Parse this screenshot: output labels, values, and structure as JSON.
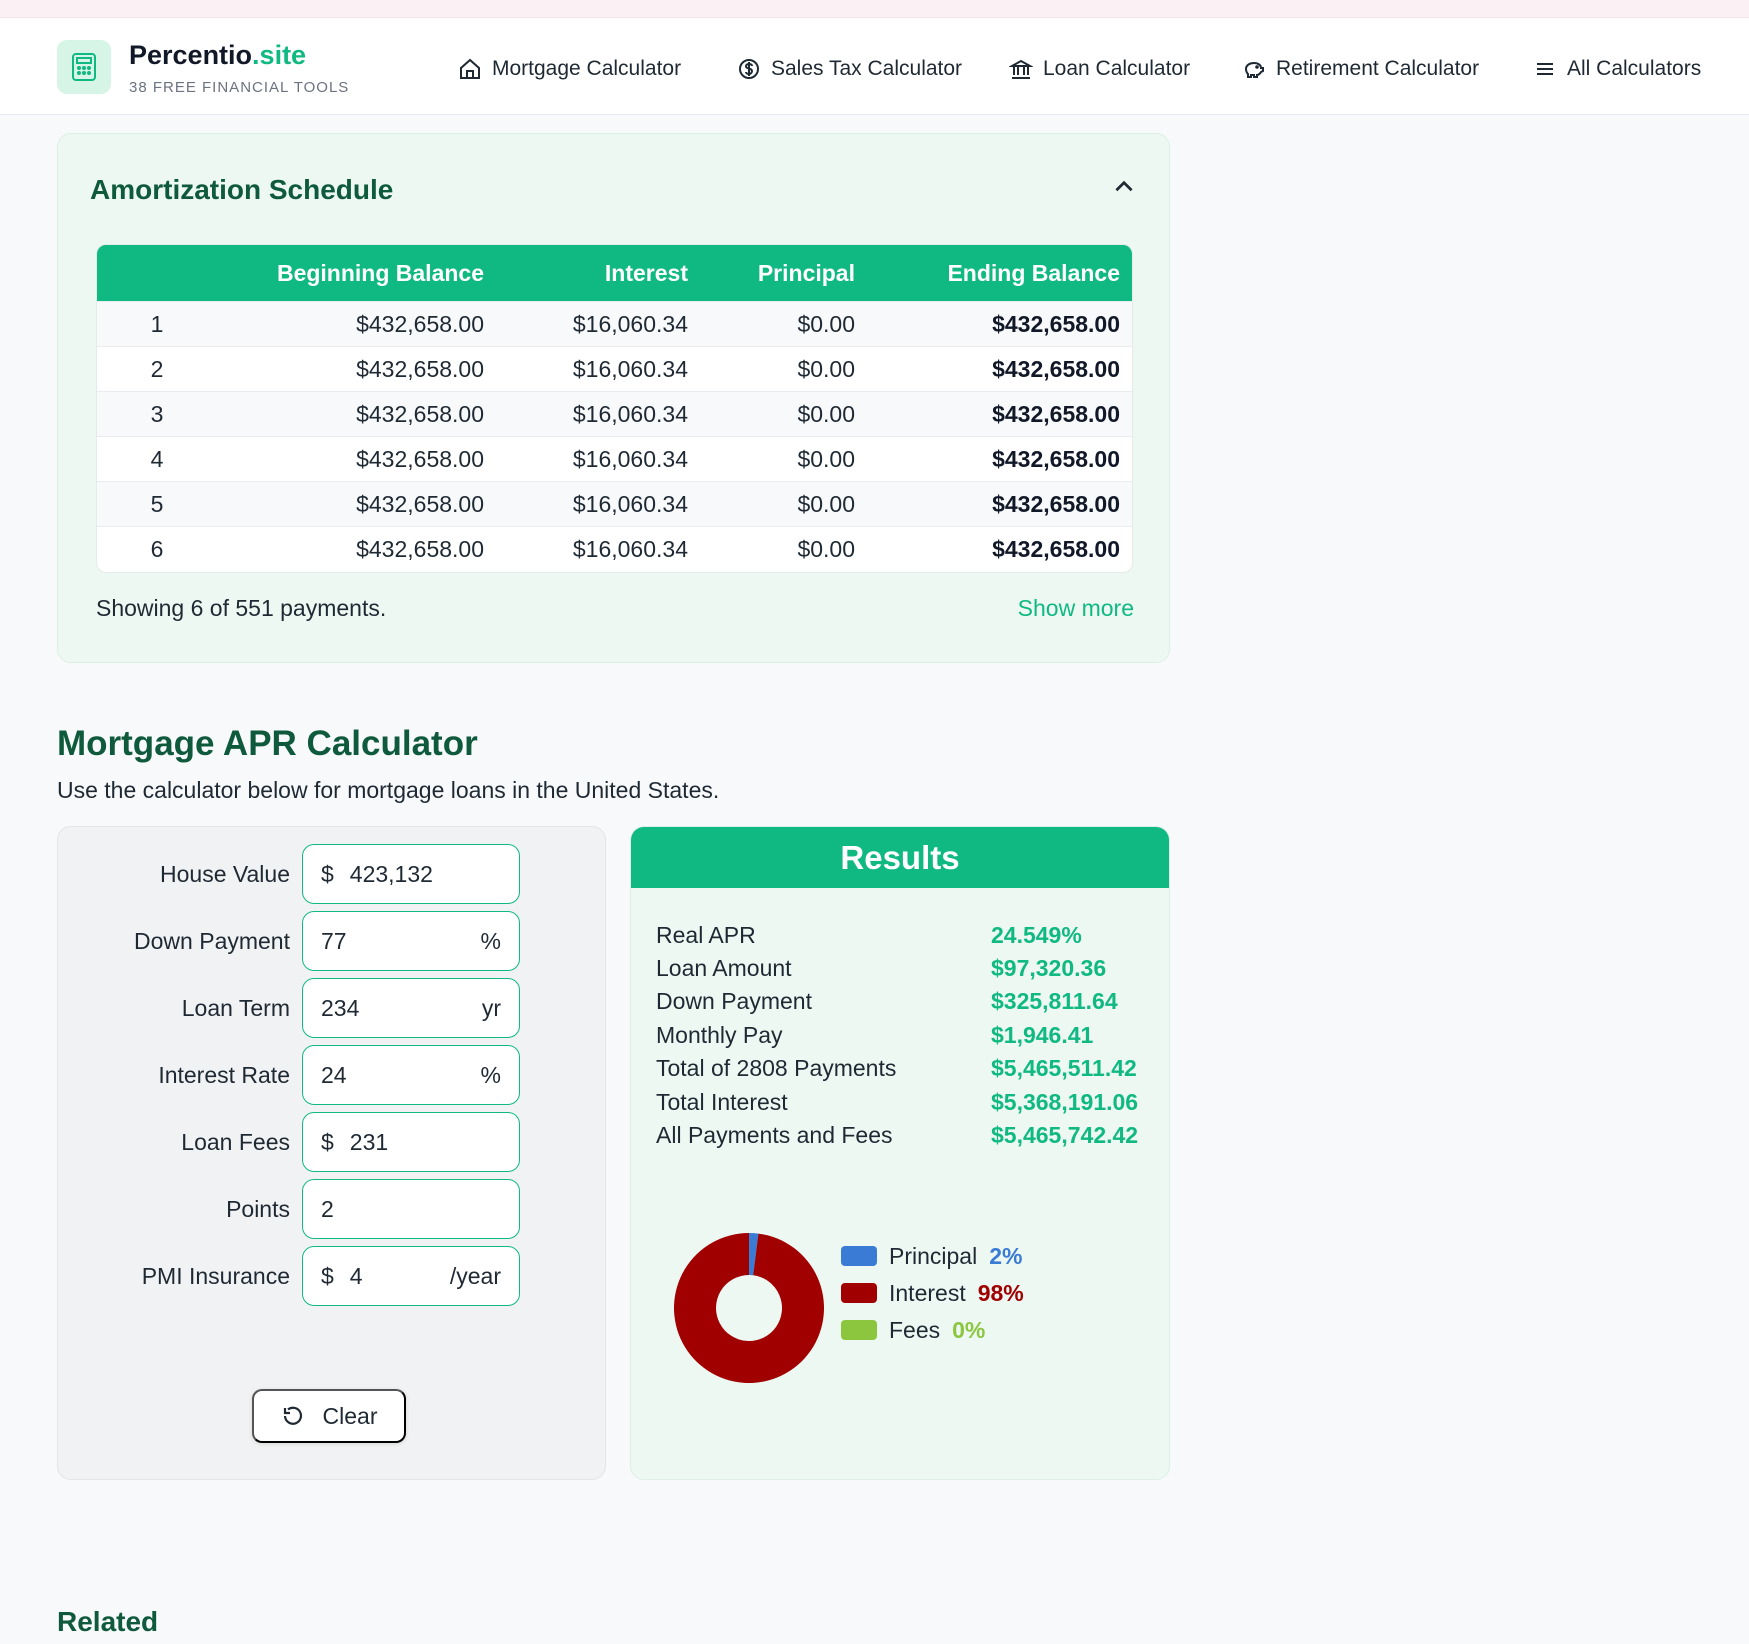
{
  "brand": {
    "name": "Percentio",
    "tld": ".site",
    "subtitle": "38 FREE FINANCIAL TOOLS"
  },
  "nav": [
    {
      "label": "Mortgage Calculator",
      "icon": "home-icon"
    },
    {
      "label": "Sales Tax Calculator",
      "icon": "dollar-circle-icon"
    },
    {
      "label": "Loan Calculator",
      "icon": "bank-icon"
    },
    {
      "label": "Retirement Calculator",
      "icon": "piggy-bank-icon"
    },
    {
      "label": "All Calculators",
      "icon": "menu-icon"
    }
  ],
  "amortization": {
    "title": "Amortization Schedule",
    "columns": [
      "",
      "Beginning Balance",
      "Interest",
      "Principal",
      "Ending Balance"
    ],
    "rows": [
      [
        "1",
        "$432,658.00",
        "$16,060.34",
        "$0.00",
        "$432,658.00"
      ],
      [
        "2",
        "$432,658.00",
        "$16,060.34",
        "$0.00",
        "$432,658.00"
      ],
      [
        "3",
        "$432,658.00",
        "$16,060.34",
        "$0.00",
        "$432,658.00"
      ],
      [
        "4",
        "$432,658.00",
        "$16,060.34",
        "$0.00",
        "$432,658.00"
      ],
      [
        "5",
        "$432,658.00",
        "$16,060.34",
        "$0.00",
        "$432,658.00"
      ],
      [
        "6",
        "$432,658.00",
        "$16,060.34",
        "$0.00",
        "$432,658.00"
      ]
    ],
    "footer": "Showing 6 of 551 payments.",
    "show_more": "Show more"
  },
  "apr": {
    "title": "Mortgage APR Calculator",
    "description": "Use the calculator below for mortgage loans in the United States."
  },
  "form": {
    "fields": [
      {
        "label": "House Value",
        "prefix": "$",
        "value": "423,132",
        "suffix": ""
      },
      {
        "label": "Down Payment",
        "prefix": "",
        "value": "77",
        "suffix": "%"
      },
      {
        "label": "Loan Term",
        "prefix": "",
        "value": "234",
        "suffix": "yr"
      },
      {
        "label": "Interest Rate",
        "prefix": "",
        "value": "24",
        "suffix": "%"
      },
      {
        "label": "Loan Fees",
        "prefix": "$",
        "value": "231",
        "suffix": ""
      },
      {
        "label": "Points",
        "prefix": "",
        "value": "2",
        "suffix": ""
      },
      {
        "label": "PMI Insurance",
        "prefix": "$",
        "value": "4",
        "suffix": "/year"
      }
    ],
    "clear_label": "Clear"
  },
  "results": {
    "title": "Results",
    "rows": [
      {
        "label": "Real APR",
        "value": "24.549%"
      },
      {
        "label": "Loan Amount",
        "value": "$97,320.36"
      },
      {
        "label": "Down Payment",
        "value": "$325,811.64"
      },
      {
        "label": "Monthly Pay",
        "value": "$1,946.41"
      },
      {
        "label": "Total of 2808 Payments",
        "value": "$5,465,511.42"
      },
      {
        "label": "Total Interest",
        "value": "$5,368,191.06"
      },
      {
        "label": "All Payments and Fees",
        "value": "$5,465,742.42"
      }
    ],
    "breakdown": [
      {
        "name": "Principal",
        "percent": 2,
        "label": "2%",
        "color": "#3a7bd5"
      },
      {
        "name": "Interest",
        "percent": 98,
        "label": "98%",
        "color": "#a00000"
      },
      {
        "name": "Fees",
        "percent": 0,
        "label": "0%",
        "color": "#8cc63f"
      }
    ]
  },
  "colors": {
    "accent": "#10b981",
    "heading": "#0f5a3c",
    "interest": "#a00000",
    "principal": "#3a7bd5",
    "fees": "#8cc63f"
  },
  "related": {
    "title": "Related"
  }
}
